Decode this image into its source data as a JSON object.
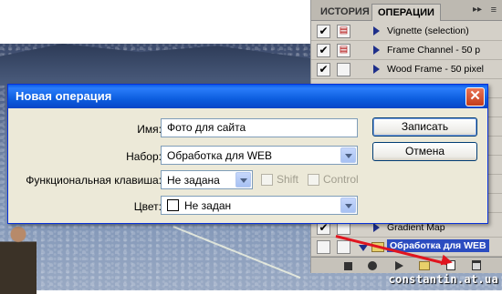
{
  "panel": {
    "tabs": [
      "ИСТОРИЯ",
      "ОПЕРАЦИИ"
    ],
    "menu_icon": "double-chevron-right-icon",
    "actions": [
      {
        "label": "Vignette (selection)",
        "checked": true,
        "dialog": true
      },
      {
        "label": "Frame Channel - 50 p",
        "checked": true,
        "dialog": true
      },
      {
        "label": "Wood Frame - 50 pixel",
        "checked": true,
        "dialog": false
      },
      {
        "label": "Gradient Map",
        "checked": true,
        "dialog": false
      },
      {
        "label": "Обработка для WEB",
        "checked": false,
        "dialog": false,
        "selected": true
      }
    ],
    "bottom_icons": [
      "stop-icon",
      "record-icon",
      "play-icon",
      "new-set-icon",
      "new-action-icon",
      "trash-icon"
    ]
  },
  "dialog": {
    "title": "Новая операция",
    "name_label": "Имя:",
    "name_value": "Фото для сайта",
    "set_label": "Набор:",
    "set_value": "Обработка для WEB",
    "fkey_label": "Функциональная клавиша:",
    "fkey_value": "Не задана",
    "shift_label": "Shift",
    "control_label": "Control",
    "color_label": "Цвет:",
    "color_value": "Не задан",
    "record_button": "Записать",
    "cancel_button": "Отмена"
  },
  "watermark": "constantin.at.ua",
  "colors": {
    "titlebar": "#0d5edf",
    "selected_action": "#2b4cc0",
    "arrow": "#e0151f"
  }
}
